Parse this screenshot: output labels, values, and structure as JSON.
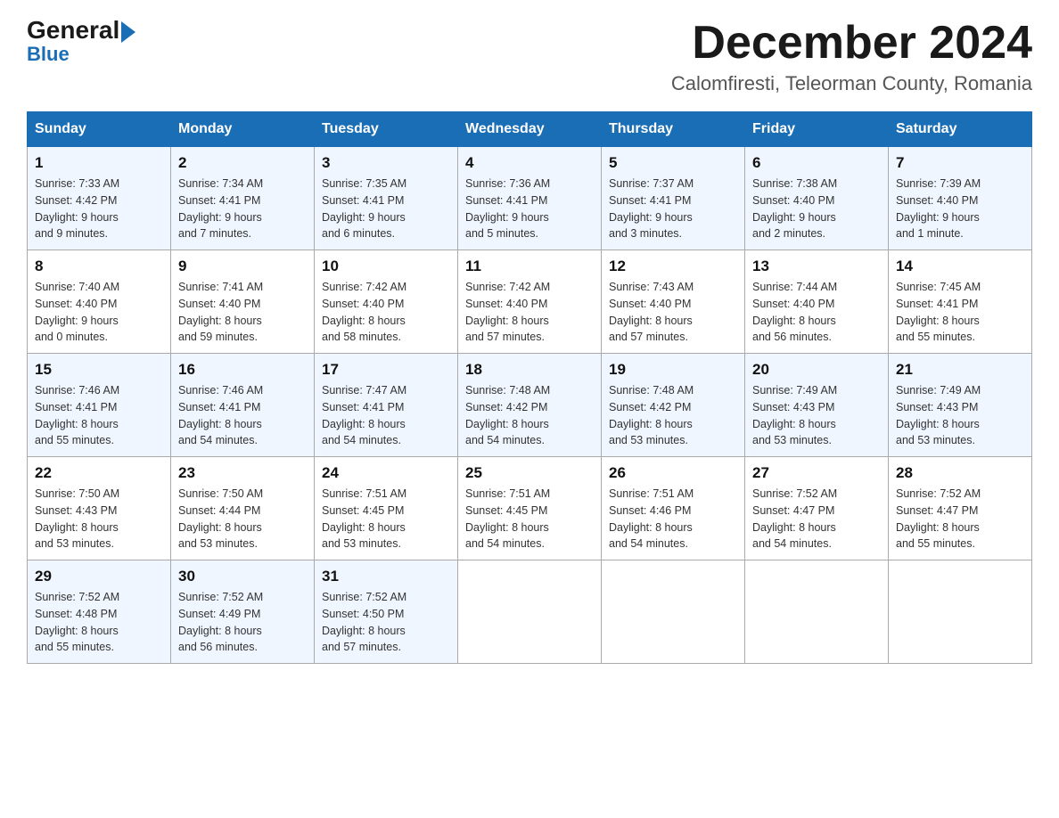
{
  "logo": {
    "general": "General",
    "triangle": "",
    "blue": "Blue"
  },
  "title": "December 2024",
  "location": "Calomfiresti, Teleorman County, Romania",
  "days_of_week": [
    "Sunday",
    "Monday",
    "Tuesday",
    "Wednesday",
    "Thursday",
    "Friday",
    "Saturday"
  ],
  "weeks": [
    [
      {
        "day": "1",
        "sunrise": "7:33 AM",
        "sunset": "4:42 PM",
        "daylight": "9 hours and 9 minutes."
      },
      {
        "day": "2",
        "sunrise": "7:34 AM",
        "sunset": "4:41 PM",
        "daylight": "9 hours and 7 minutes."
      },
      {
        "day": "3",
        "sunrise": "7:35 AM",
        "sunset": "4:41 PM",
        "daylight": "9 hours and 6 minutes."
      },
      {
        "day": "4",
        "sunrise": "7:36 AM",
        "sunset": "4:41 PM",
        "daylight": "9 hours and 5 minutes."
      },
      {
        "day": "5",
        "sunrise": "7:37 AM",
        "sunset": "4:41 PM",
        "daylight": "9 hours and 3 minutes."
      },
      {
        "day": "6",
        "sunrise": "7:38 AM",
        "sunset": "4:40 PM",
        "daylight": "9 hours and 2 minutes."
      },
      {
        "day": "7",
        "sunrise": "7:39 AM",
        "sunset": "4:40 PM",
        "daylight": "9 hours and 1 minute."
      }
    ],
    [
      {
        "day": "8",
        "sunrise": "7:40 AM",
        "sunset": "4:40 PM",
        "daylight": "9 hours and 0 minutes."
      },
      {
        "day": "9",
        "sunrise": "7:41 AM",
        "sunset": "4:40 PM",
        "daylight": "8 hours and 59 minutes."
      },
      {
        "day": "10",
        "sunrise": "7:42 AM",
        "sunset": "4:40 PM",
        "daylight": "8 hours and 58 minutes."
      },
      {
        "day": "11",
        "sunrise": "7:42 AM",
        "sunset": "4:40 PM",
        "daylight": "8 hours and 57 minutes."
      },
      {
        "day": "12",
        "sunrise": "7:43 AM",
        "sunset": "4:40 PM",
        "daylight": "8 hours and 57 minutes."
      },
      {
        "day": "13",
        "sunrise": "7:44 AM",
        "sunset": "4:40 PM",
        "daylight": "8 hours and 56 minutes."
      },
      {
        "day": "14",
        "sunrise": "7:45 AM",
        "sunset": "4:41 PM",
        "daylight": "8 hours and 55 minutes."
      }
    ],
    [
      {
        "day": "15",
        "sunrise": "7:46 AM",
        "sunset": "4:41 PM",
        "daylight": "8 hours and 55 minutes."
      },
      {
        "day": "16",
        "sunrise": "7:46 AM",
        "sunset": "4:41 PM",
        "daylight": "8 hours and 54 minutes."
      },
      {
        "day": "17",
        "sunrise": "7:47 AM",
        "sunset": "4:41 PM",
        "daylight": "8 hours and 54 minutes."
      },
      {
        "day": "18",
        "sunrise": "7:48 AM",
        "sunset": "4:42 PM",
        "daylight": "8 hours and 54 minutes."
      },
      {
        "day": "19",
        "sunrise": "7:48 AM",
        "sunset": "4:42 PM",
        "daylight": "8 hours and 53 minutes."
      },
      {
        "day": "20",
        "sunrise": "7:49 AM",
        "sunset": "4:43 PM",
        "daylight": "8 hours and 53 minutes."
      },
      {
        "day": "21",
        "sunrise": "7:49 AM",
        "sunset": "4:43 PM",
        "daylight": "8 hours and 53 minutes."
      }
    ],
    [
      {
        "day": "22",
        "sunrise": "7:50 AM",
        "sunset": "4:43 PM",
        "daylight": "8 hours and 53 minutes."
      },
      {
        "day": "23",
        "sunrise": "7:50 AM",
        "sunset": "4:44 PM",
        "daylight": "8 hours and 53 minutes."
      },
      {
        "day": "24",
        "sunrise": "7:51 AM",
        "sunset": "4:45 PM",
        "daylight": "8 hours and 53 minutes."
      },
      {
        "day": "25",
        "sunrise": "7:51 AM",
        "sunset": "4:45 PM",
        "daylight": "8 hours and 54 minutes."
      },
      {
        "day": "26",
        "sunrise": "7:51 AM",
        "sunset": "4:46 PM",
        "daylight": "8 hours and 54 minutes."
      },
      {
        "day": "27",
        "sunrise": "7:52 AM",
        "sunset": "4:47 PM",
        "daylight": "8 hours and 54 minutes."
      },
      {
        "day": "28",
        "sunrise": "7:52 AM",
        "sunset": "4:47 PM",
        "daylight": "8 hours and 55 minutes."
      }
    ],
    [
      {
        "day": "29",
        "sunrise": "7:52 AM",
        "sunset": "4:48 PM",
        "daylight": "8 hours and 55 minutes."
      },
      {
        "day": "30",
        "sunrise": "7:52 AM",
        "sunset": "4:49 PM",
        "daylight": "8 hours and 56 minutes."
      },
      {
        "day": "31",
        "sunrise": "7:52 AM",
        "sunset": "4:50 PM",
        "daylight": "8 hours and 57 minutes."
      },
      null,
      null,
      null,
      null
    ]
  ],
  "labels": {
    "sunrise": "Sunrise:",
    "sunset": "Sunset:",
    "daylight": "Daylight:"
  }
}
